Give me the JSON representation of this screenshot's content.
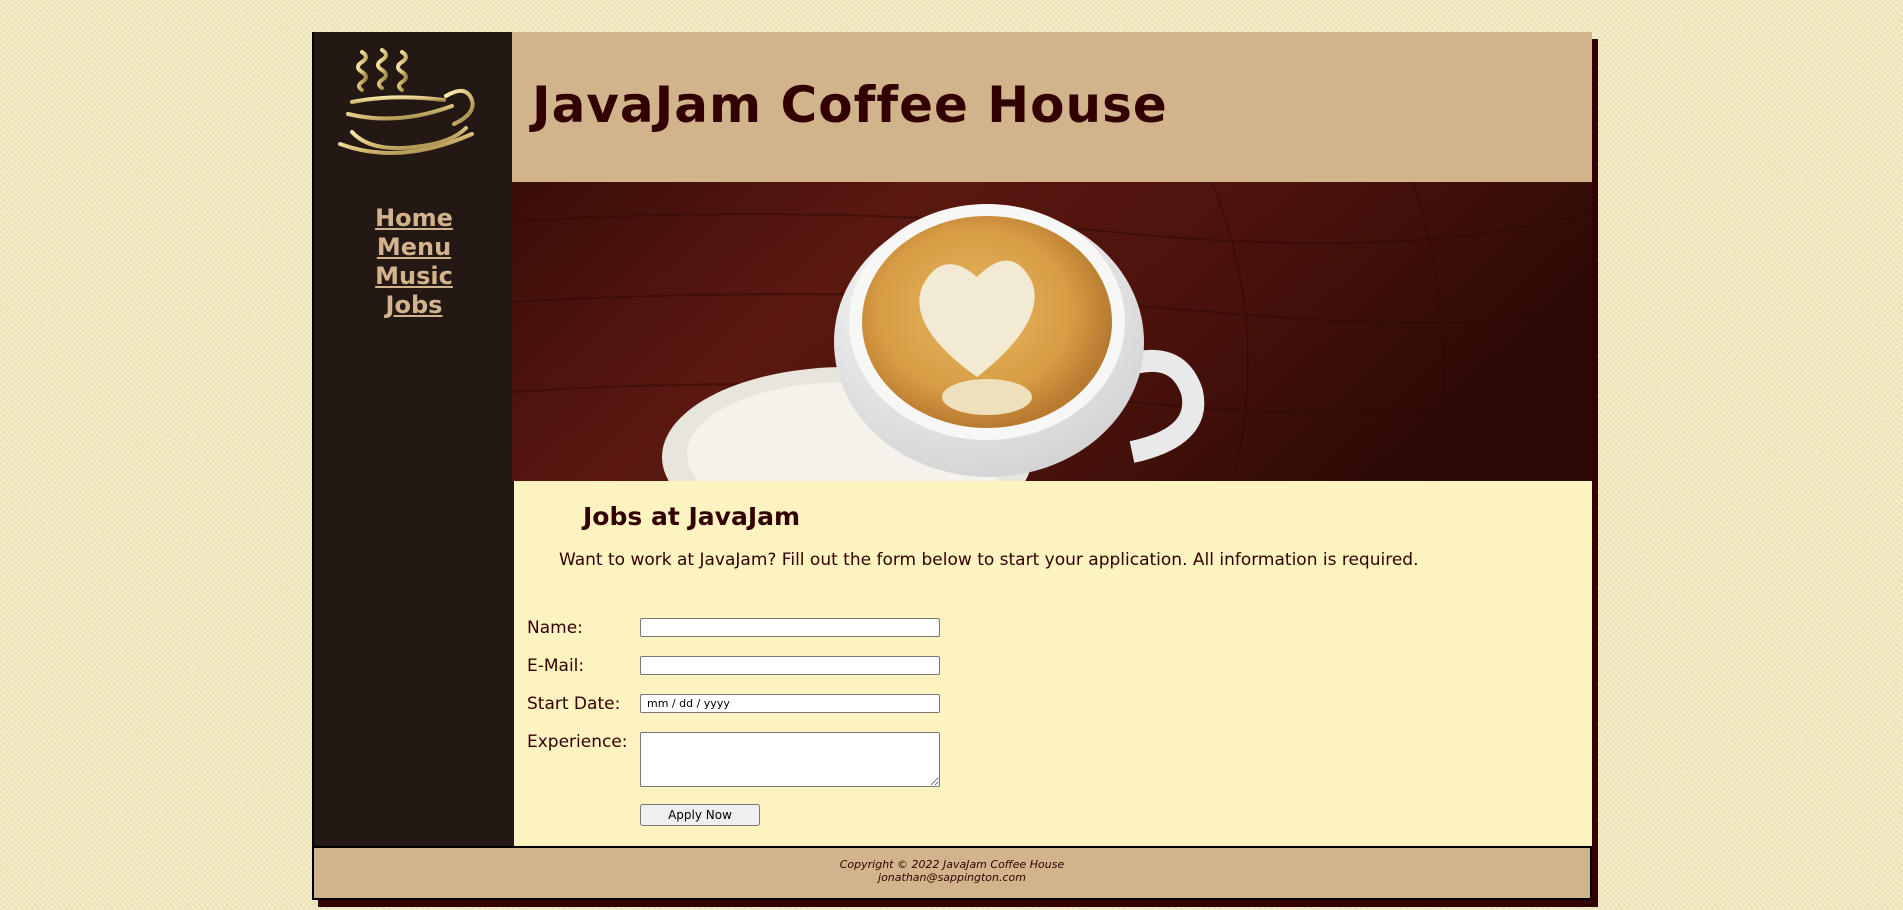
{
  "site": {
    "title": "JavaJam Coffee House"
  },
  "nav": {
    "items": [
      {
        "label": "Home"
      },
      {
        "label": "Menu"
      },
      {
        "label": "Music"
      },
      {
        "label": "Jobs"
      }
    ]
  },
  "main": {
    "heading": "Jobs at JavaJam",
    "intro": "Want to work at JavaJam? Fill out the form below to start your application. All information is required.",
    "form": {
      "name_label": "Name:",
      "email_label": "E-Mail:",
      "start_date_label": "Start Date:",
      "start_date_value": "mm / dd / yyyy",
      "experience_label": "Experience:",
      "submit_label": "Apply Now"
    }
  },
  "footer": {
    "copyright": "Copyright © 2022 JavaJam Coffee House",
    "email": "jonathan@sappington.com"
  },
  "colors": {
    "sidebar_bg": "#231814",
    "header_bg": "#d2b48c",
    "content_bg": "#fcf3c0",
    "text": "#330000",
    "nav_link": "#d3b38b"
  }
}
